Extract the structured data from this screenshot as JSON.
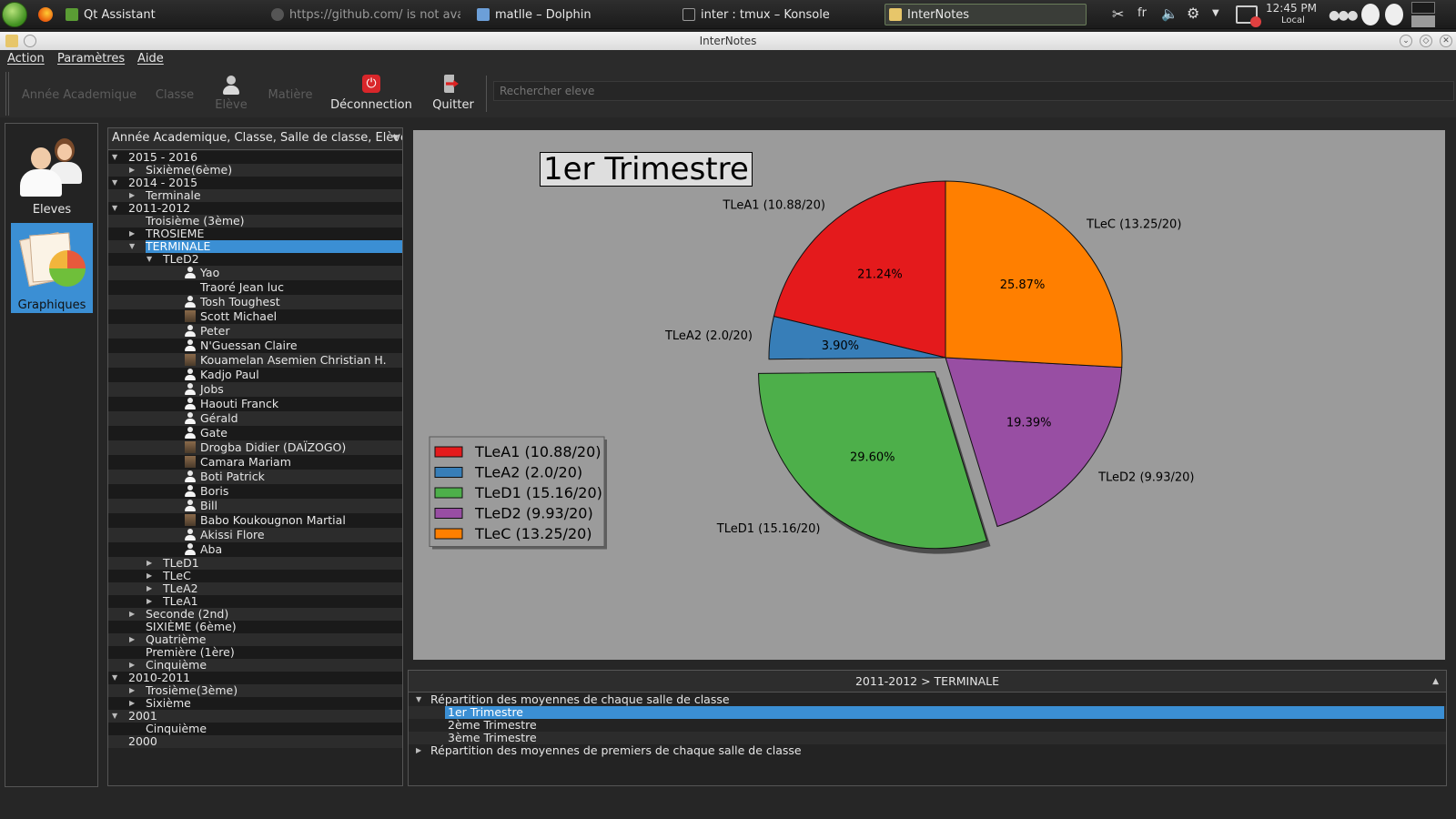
{
  "taskbar": {
    "tasks": [
      {
        "label": "Qt Assistant"
      },
      {
        "label": "https://github.com/ is not avai"
      },
      {
        "label": "matlle – Dolphin"
      },
      {
        "label": "inter : tmux – Konsole"
      },
      {
        "label": "InterNotes"
      }
    ],
    "language": "fr",
    "clock_time": "12:45 PM",
    "clock_zone": "Local"
  },
  "window": {
    "title": "InterNotes"
  },
  "menubar": {
    "items": [
      "Action",
      "Paramètres",
      "Aide"
    ]
  },
  "toolbar": {
    "annee": "Année Academique",
    "classe": "Classe",
    "eleve": "Elève",
    "matiere": "Matière",
    "deconnexion": "Déconnection",
    "quitter": "Quitter",
    "search_placeholder": "Rechercher eleve"
  },
  "left_panel": {
    "items": [
      {
        "label": "Eleves"
      },
      {
        "label": "Graphiques"
      }
    ]
  },
  "tree": {
    "header": "Année Academique, Classe, Salle de classe, Elève",
    "rows": [
      {
        "label": "2015 - 2016"
      },
      {
        "label": "Sixième(6ème)"
      },
      {
        "label": "2014 - 2015"
      },
      {
        "label": "Terminale"
      },
      {
        "label": "2011-2012"
      },
      {
        "label": "Troisième  (3ème)"
      },
      {
        "label": "TROSIEME"
      },
      {
        "label": "TERMINALE"
      },
      {
        "label": "TLeD2"
      },
      {
        "label": "Yao"
      },
      {
        "label": "Traoré Jean luc"
      },
      {
        "label": "Tosh Toughest"
      },
      {
        "label": "Scott Michael"
      },
      {
        "label": "Peter"
      },
      {
        "label": "N'Guessan Claire"
      },
      {
        "label": "Kouamelan Asemien Christian H."
      },
      {
        "label": "Kadjo Paul"
      },
      {
        "label": "Jobs"
      },
      {
        "label": "Haouti Franck"
      },
      {
        "label": "Gérald"
      },
      {
        "label": "Gate"
      },
      {
        "label": "Drogba Didier (DAÏZOGO)"
      },
      {
        "label": "Camara Mariam"
      },
      {
        "label": "Boti Patrick"
      },
      {
        "label": "Boris"
      },
      {
        "label": "Bill"
      },
      {
        "label": "Babo Koukougnon Martial"
      },
      {
        "label": "Akissi Flore"
      },
      {
        "label": "Aba"
      },
      {
        "label": "TLeD1"
      },
      {
        "label": "TLeC"
      },
      {
        "label": "TLeA2"
      },
      {
        "label": "TLeA1"
      },
      {
        "label": "Seconde (2nd)"
      },
      {
        "label": "SIXIÈME (6ème)"
      },
      {
        "label": "Quatrième"
      },
      {
        "label": "Première (1ère)"
      },
      {
        "label": "Cinquième"
      },
      {
        "label": "2010-2011"
      },
      {
        "label": "Trosième(3ème)"
      },
      {
        "label": "Sixième"
      },
      {
        "label": "2001"
      },
      {
        "label": "Cinquième"
      },
      {
        "label": "2000"
      }
    ]
  },
  "chart_data": {
    "type": "pie",
    "title": "1er Trimestre",
    "categories": [
      "TLeA1 (10.88/20)",
      "TLeA2 (2.0/20)",
      "TLeD1 (15.16/20)",
      "TLeD2 (9.93/20)",
      "TLeC (13.25/20)"
    ],
    "values": [
      21.24,
      3.9,
      29.6,
      19.39,
      25.87
    ],
    "value_labels": [
      "21.24%",
      "3.90%",
      "29.60%",
      "19.39%",
      "25.87%"
    ],
    "colors": [
      "#e41a1c",
      "#377eb8",
      "#4daf4a",
      "#984ea3",
      "#ff7f00"
    ],
    "exploded": "TLeD1 (15.16/20)",
    "legend": {
      "position": "left",
      "entries": [
        "TLeA1 (10.88/20)",
        "TLeA2 (2.0/20)",
        "TLeD1 (15.16/20)",
        "TLeD2 (9.93/20)",
        "TLeC (13.25/20)"
      ]
    }
  },
  "bottom_panel": {
    "header": "2011-2012 > TERMINALE",
    "rows": [
      {
        "label": "Répartition des moyennes de chaque salle de classe"
      },
      {
        "label": "1er Trimestre"
      },
      {
        "label": "2ème Trimestre"
      },
      {
        "label": "3ème Trimestre"
      },
      {
        "label": "Répartition des moyennes de premiers de chaque salle de classe"
      }
    ]
  }
}
